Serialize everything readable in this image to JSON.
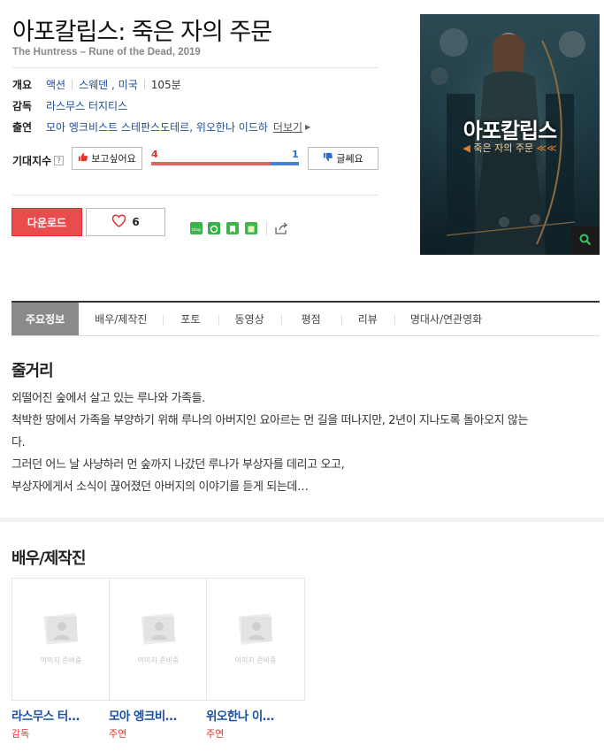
{
  "movie": {
    "title": "아포칼립스: 죽은 자의 주문",
    "original_title": "The Huntress – Rune of the Dead, 2019"
  },
  "info": {
    "overview_label": "개요",
    "genre": "액션",
    "countries": "스웨덴 , 미국",
    "runtime": "105분",
    "director_label": "감독",
    "director": "라스무스 터지티스",
    "cast_label": "출연",
    "cast": "모아 엥크비스트 스테판스도테르, 위오한나 이드하",
    "more": "더보기"
  },
  "expectation": {
    "label": "기대지수",
    "help": "?",
    "want_label": "보고싶어요",
    "want_count": "4",
    "meh_count": "1",
    "meh_label": "글쎄요",
    "want_ratio": 0.8
  },
  "actions": {
    "download_label": "다운로드",
    "like_count": "6"
  },
  "poster": {
    "title": "아포칼립스",
    "subtitle": "죽은 자의 주문"
  },
  "tabs": [
    "주요정보",
    "배우/제작진",
    "포토",
    "동영상",
    "평점",
    "리뷰",
    "명대사/연관영화"
  ],
  "synopsis": {
    "heading": "줄거리",
    "lines": [
      "외떨어진 숲에서 살고 있는 루나와 가족들.",
      " 척박한 땅에서 가족을 부양하기 위해 루나의 아버지인 요아르는 먼 길을 떠나지만, 2년이 지나도록 돌아오지 않는",
      "다.",
      " 그러던 어느 날 사냥하러 먼 숲까지 나갔던 루나가 부상자를 데리고 오고,",
      " 부상자에게서 소식이 끊어졌던 아버지의 이야기를 듣게 되는데…"
    ]
  },
  "crew": {
    "heading": "배우/제작진",
    "placeholder": "이미지 준비중",
    "people": [
      {
        "name": "라스무스 터…",
        "role": "감독"
      },
      {
        "name": "모아 엥크비…",
        "role": "주연"
      },
      {
        "name": "위오한나 이…",
        "role": "주연"
      }
    ]
  },
  "colors": {
    "accent_red": "#e84c4c",
    "link_blue": "#1a4fa0",
    "gauge_blue": "#4a7fdc"
  }
}
